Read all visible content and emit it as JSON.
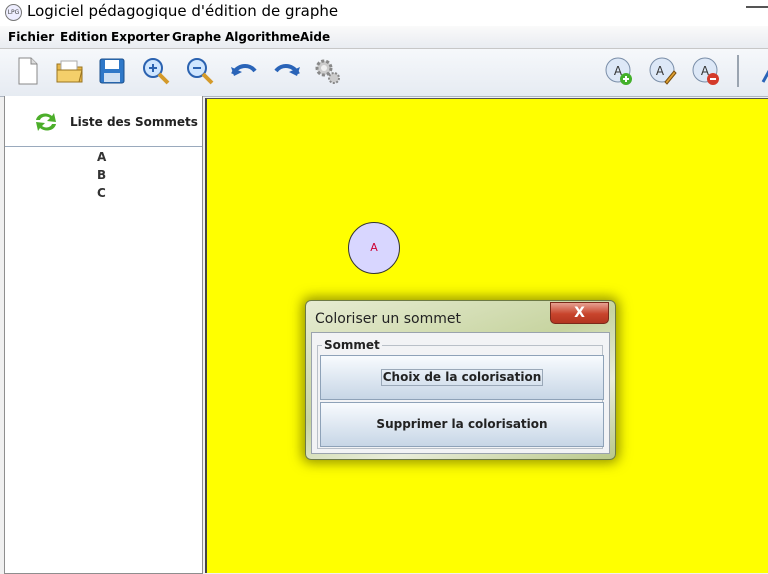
{
  "window": {
    "title": "Logiciel pédagogique d'édition de graphe"
  },
  "menu": [
    "Fichier",
    "Edition",
    "Exporter",
    "Graphe",
    "Algorithme",
    "Aide"
  ],
  "toolbar_icons": [
    "new-file-icon",
    "open-folder-icon",
    "save-icon",
    "zoom-in-icon",
    "zoom-out-icon",
    "undo-icon",
    "redo-icon",
    "settings-gear-icon",
    "add-vertex-icon",
    "edit-vertex-icon",
    "delete-vertex-icon"
  ],
  "sidebar": {
    "title": "Liste des Sommets",
    "vertices": [
      "A",
      "B",
      "C"
    ]
  },
  "canvas": {
    "background": "#ffff00",
    "vertex": {
      "label": "A",
      "fill": "#d8d6ff"
    }
  },
  "dialog": {
    "title": "Coloriser un sommet",
    "close_label": "X",
    "group_label": "Sommet",
    "choose_button": "Choix de la colorisation",
    "remove_button": "Supprimer la colorisation"
  }
}
